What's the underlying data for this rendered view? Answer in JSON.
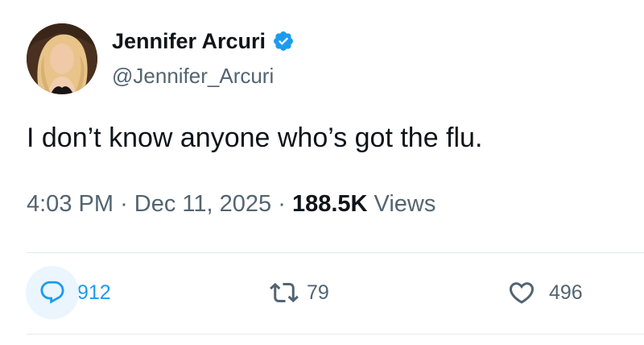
{
  "tweet": {
    "author": {
      "display_name": "Jennifer Arcuri",
      "handle": "@Jennifer_Arcuri",
      "verified": true,
      "avatar_icon": "profile-photo"
    },
    "text": "I don’t know anyone who’s got the flu.",
    "time": "4:03 PM",
    "separator": "·",
    "date": "Dec 11, 2025",
    "views_count": "188.5K",
    "views_label": "Views",
    "actions": {
      "reply": {
        "icon": "reply-icon",
        "count": "912"
      },
      "repost": {
        "icon": "repost-icon",
        "count": "79"
      },
      "like": {
        "icon": "heart-icon",
        "count": "496"
      }
    }
  },
  "colors": {
    "text_primary": "#0f1419",
    "text_secondary": "#536471",
    "accent_blue": "#1d9bf0",
    "reply_highlight": "#eaf5fe",
    "divider": "#e6e9ec"
  }
}
